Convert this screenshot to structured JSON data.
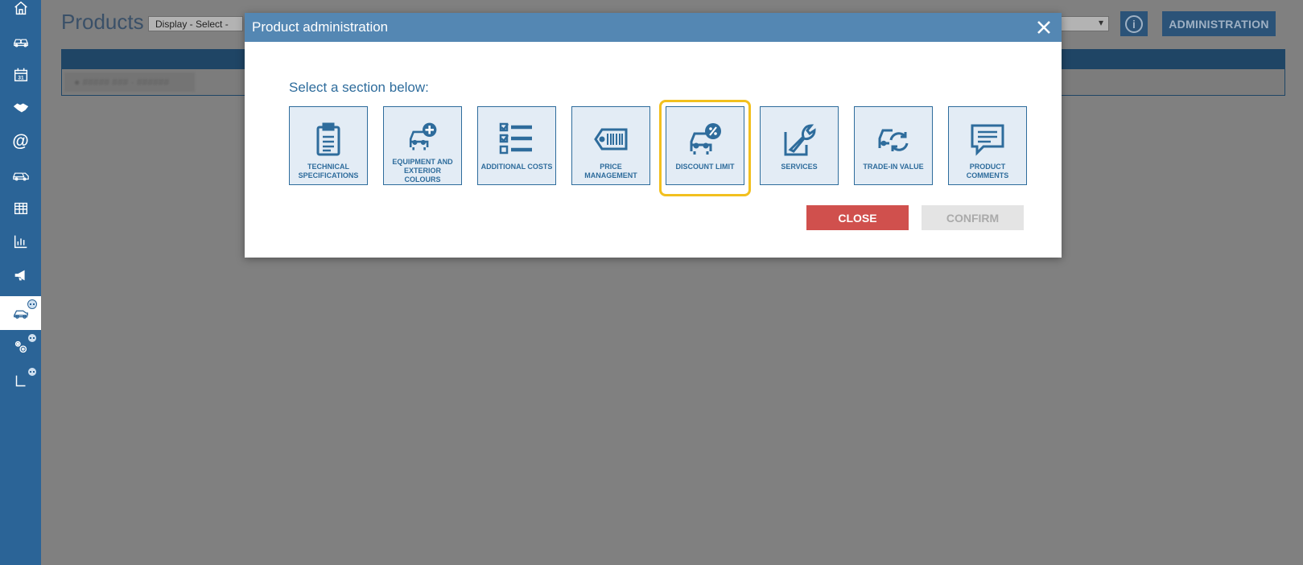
{
  "page": {
    "title": "Products",
    "display_select": "Display - Select -",
    "admin_button": "ADMINISTRATION",
    "info_icon": "i",
    "blurred_row": "● ##### ### · ######"
  },
  "sidebar": {
    "items": [
      {
        "icon": "home-icon"
      },
      {
        "icon": "cars-group-icon"
      },
      {
        "icon": "calendar-icon",
        "text": "31"
      },
      {
        "icon": "handshake-icon"
      },
      {
        "icon": "at-icon",
        "text": "@"
      },
      {
        "icon": "car-fleet-icon"
      },
      {
        "icon": "table-icon"
      },
      {
        "icon": "bar-chart-icon"
      },
      {
        "icon": "megaphone-icon"
      },
      {
        "icon": "car-active-icon",
        "badge": true
      },
      {
        "icon": "gears-icon",
        "badge": true
      },
      {
        "icon": "corner-icon",
        "badge": true
      }
    ]
  },
  "modal": {
    "title": "Product administration",
    "prompt": "Select a section below:",
    "tiles": [
      {
        "label": "Technical specifications",
        "icon": "clipboard-icon"
      },
      {
        "label": "Equipment and exterior colours",
        "icon": "car-plus-icon"
      },
      {
        "label": "Additional costs",
        "icon": "checklist-icon"
      },
      {
        "label": "Price management",
        "icon": "price-tag-icon"
      },
      {
        "label": "Discount limit",
        "icon": "car-percent-icon",
        "selected": true
      },
      {
        "label": "Services",
        "icon": "wrench-icon"
      },
      {
        "label": "Trade-in value",
        "icon": "car-cycle-icon"
      },
      {
        "label": "Product comments",
        "icon": "comment-icon"
      }
    ],
    "close_button": "CLOSE",
    "confirm_button": "CONFIRM"
  },
  "colors": {
    "sidebar": "#2b6497",
    "modal_header": "#5487b3",
    "tile_border": "#2e6c9c",
    "selected_outline": "#f2c01e",
    "close_button": "#d0504d",
    "confirm_button": "#e4e4e4",
    "overlay": "#808080"
  }
}
